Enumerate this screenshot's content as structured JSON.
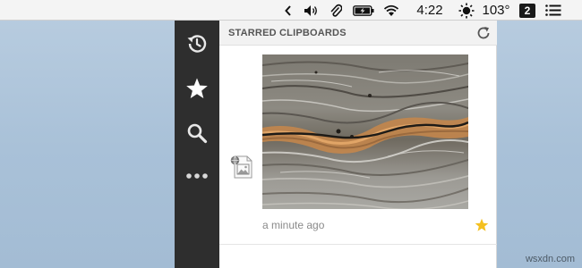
{
  "menubar": {
    "time": "4:22",
    "temperature": "103°",
    "workspace_number": "2",
    "icons": [
      "chevron-left-icon",
      "volume-icon",
      "paperclip-icon",
      "battery-charging-icon",
      "wifi-icon",
      "weather-sun-icon",
      "list-menu-icon"
    ]
  },
  "sidebar": {
    "items": [
      {
        "name": "history",
        "icon": "history-icon"
      },
      {
        "name": "starred",
        "icon": "star-icon"
      },
      {
        "name": "search",
        "icon": "search-icon"
      },
      {
        "name": "more",
        "icon": "more-icon"
      }
    ]
  },
  "panel": {
    "title": "STARRED CLIPBOARDS",
    "refresh_icon": "refresh-icon"
  },
  "clip": {
    "type_icon": "image-file-icon",
    "time_label": "a minute ago",
    "starred": true,
    "star_color": "#f4c020"
  },
  "watermark": "wsxdn.com"
}
